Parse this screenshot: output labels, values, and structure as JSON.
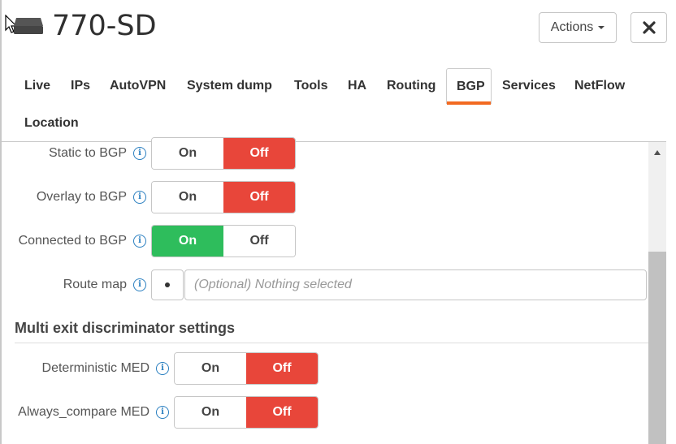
{
  "header": {
    "title": "770-SD",
    "actions_label": "Actions",
    "close_symbol": "✖"
  },
  "tabs": [
    {
      "label": "Live",
      "active": false
    },
    {
      "label": "IPs",
      "active": false
    },
    {
      "label": "AutoVPN",
      "active": false
    },
    {
      "label": "System dump",
      "active": false
    },
    {
      "label": "Tools",
      "active": false
    },
    {
      "label": "HA",
      "active": false
    },
    {
      "label": "Routing",
      "active": false
    },
    {
      "label": "BGP",
      "active": true
    },
    {
      "label": "Services",
      "active": false
    },
    {
      "label": "NetFlow",
      "active": false
    },
    {
      "label": "Location",
      "active": false
    }
  ],
  "toggles_common": {
    "on": "On",
    "off": "Off",
    "info_icon": "i"
  },
  "settings": {
    "static_to_bgp": {
      "label": "Static to BGP",
      "value": "Off"
    },
    "overlay_to_bgp": {
      "label": "Overlay to BGP",
      "value": "Off"
    },
    "connected_to_bgp": {
      "label": "Connected to BGP",
      "value": "On"
    },
    "route_map": {
      "label": "Route map",
      "placeholder": "(Optional) Nothing selected"
    }
  },
  "med_section": {
    "title": "Multi exit discriminator settings",
    "deterministic_med": {
      "label": "Deterministic MED",
      "value": "Off"
    },
    "always_compare_med": {
      "label": "Always_compare MED",
      "value": "Off"
    }
  },
  "colors": {
    "off_active": "#e8463a",
    "on_active": "#2ebd5c",
    "tab_accent": "#f26a21",
    "info": "#2a7fc0"
  }
}
